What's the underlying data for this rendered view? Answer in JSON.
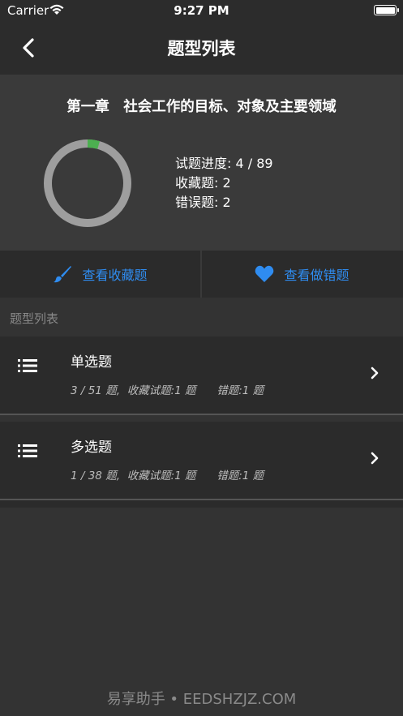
{
  "status_bar": {
    "carrier": "Carrier",
    "time": "9:27 PM"
  },
  "nav": {
    "title": "题型列表",
    "back_icon": "chevron-left-icon"
  },
  "summary": {
    "chapter_title": "第一章　社会工作的目标、对象及主要领域",
    "progress_label": "试题进度: 4 / 89",
    "favorites_label": "收藏题: 2",
    "wrong_label": "错误题: 2",
    "progress_fraction": 0.045,
    "ring_color": "#9e9e9e",
    "progress_color": "#4caf50"
  },
  "actions": {
    "view_favorites": "查看收藏题",
    "view_wrong": "查看做错题",
    "accent_color": "#2f8cf0"
  },
  "section_header": "题型列表",
  "question_types": [
    {
      "name": "单选题",
      "meta": "3 / 51 题,  收藏试题:1 题      错题:1 题"
    },
    {
      "name": "多选题",
      "meta": "1 / 38 题,  收藏试题:1 题      错题:1 题"
    }
  ],
  "watermark": "易享助手 • EEDSHZJZ.COM"
}
